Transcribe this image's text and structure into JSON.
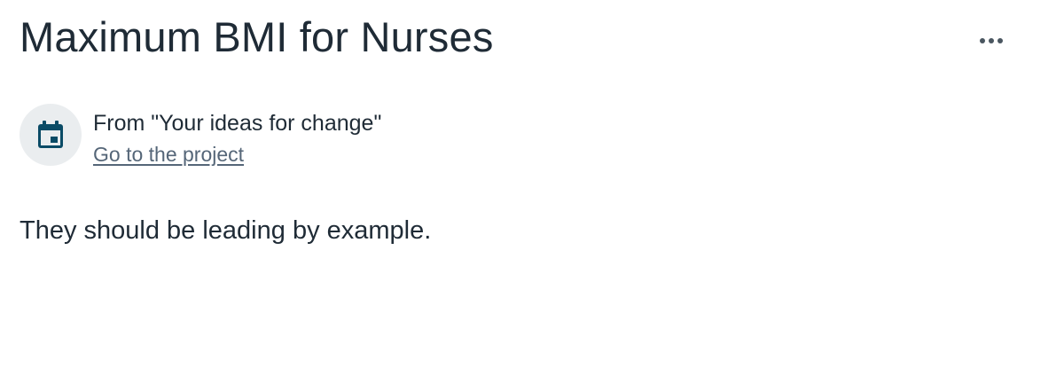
{
  "post": {
    "title": "Maximum BMI for Nurses",
    "body": "They should be leading by example."
  },
  "source": {
    "from_label": "From \"Your ideas for change\"",
    "link_label": "Go to the project",
    "icon": "calendar-icon",
    "icon_color": "#0a4b66"
  },
  "actions": {
    "more_icon": "more-options-icon"
  },
  "colors": {
    "text": "#1f2b36",
    "link": "#556678",
    "avatar_bg": "#eaedef"
  }
}
